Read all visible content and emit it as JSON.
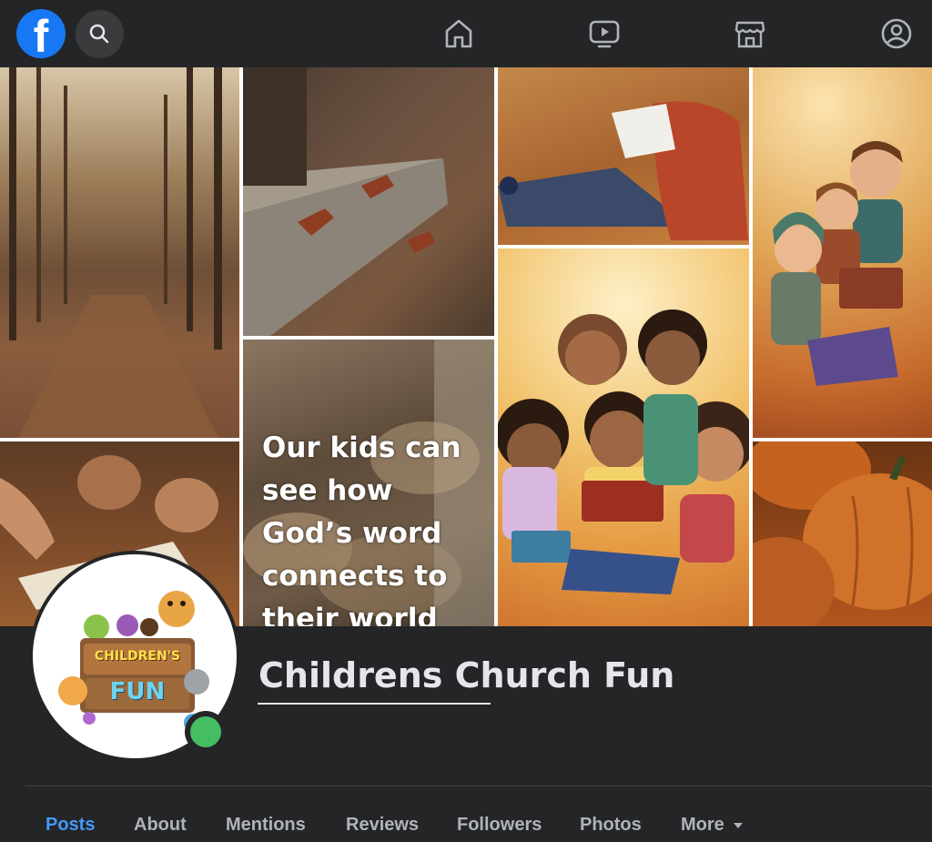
{
  "app": {
    "logo_letter": "f"
  },
  "cover": {
    "quote": "Our kids can see how God’s word connects to their world"
  },
  "profile": {
    "name": "Childrens Church Fun",
    "avatar_text_1": "CHILDREN'S",
    "avatar_text_2": "FUN",
    "online_color": "#45bd62"
  },
  "tabs": [
    {
      "label": "Posts",
      "active": true
    },
    {
      "label": "About"
    },
    {
      "label": "Mentions"
    },
    {
      "label": "Reviews"
    },
    {
      "label": "Followers"
    },
    {
      "label": "Photos"
    },
    {
      "label": "More"
    }
  ],
  "colors": {
    "brand": "#1877f2",
    "active_tab": "#4599ff",
    "background": "#242526"
  },
  "icons": [
    "facebook-logo",
    "search-icon",
    "home-icon",
    "video-icon",
    "marketplace-icon",
    "account-icon",
    "chevron-down-icon"
  ]
}
